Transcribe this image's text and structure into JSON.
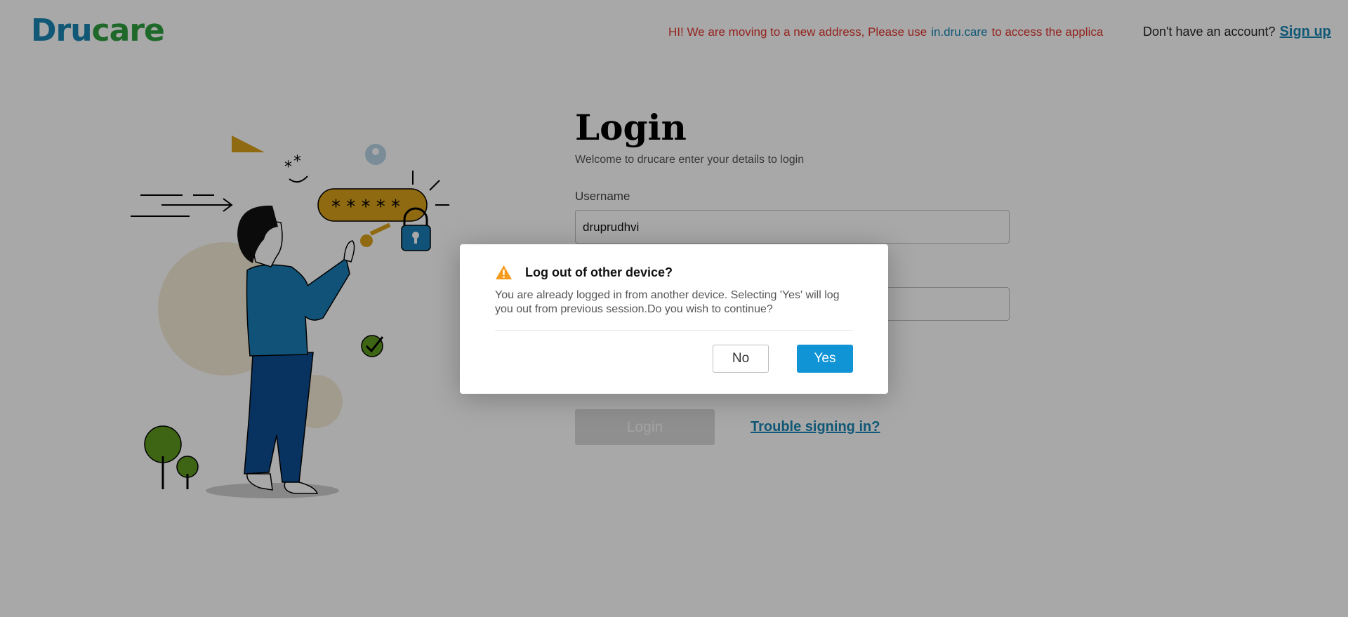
{
  "header": {
    "logo_dru": "Dru",
    "logo_care": "care",
    "announcement_prefix": "HI! We are moving to a new address, Please use",
    "announcement_link": "in.dru.care",
    "announcement_suffix": "to access the applica",
    "no_account_text": "Don't have an account?",
    "signup_label": "Sign up"
  },
  "login": {
    "title": "Login",
    "subtitle": "Welcome to drucare enter your details to login",
    "username_label": "Username",
    "username_value": "druprudhvi",
    "password_value": "",
    "login_button": "Login",
    "trouble_link": "Trouble signing in?"
  },
  "illustration": {
    "password_mask": "* * * * *"
  },
  "modal": {
    "icon": "warning-icon",
    "title": "Log out of other device?",
    "body": "You are already logged in from another device. Selecting 'Yes' will log you out from previous session.Do you wish to continue?",
    "no_label": "No",
    "yes_label": "Yes"
  },
  "colors": {
    "brand_blue": "#1a86b4",
    "brand_green": "#2e9e3f",
    "primary_button": "#1094d6",
    "announcement_red": "#e0342c",
    "warning_orange": "#f59b1c"
  }
}
